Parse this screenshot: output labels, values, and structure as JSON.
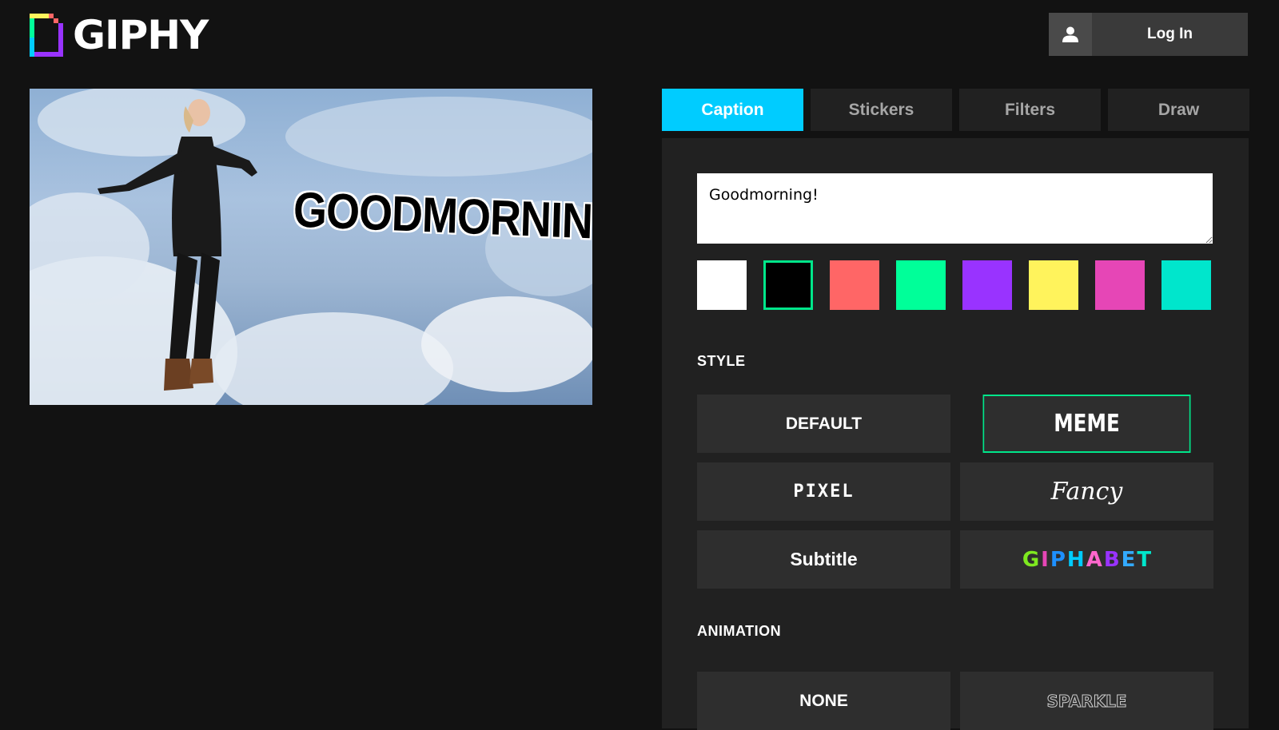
{
  "header": {
    "logo_text": "GIPHY",
    "login_label": "Log In",
    "login_icon": "user-icon"
  },
  "preview": {
    "caption": "GOODMORNING!"
  },
  "tabs": [
    {
      "label": "Caption",
      "active": true
    },
    {
      "label": "Stickers",
      "active": false
    },
    {
      "label": "Filters",
      "active": false
    },
    {
      "label": "Draw",
      "active": false
    }
  ],
  "caption_panel": {
    "input_value": "Goodmorning!",
    "colors": [
      "#ffffff",
      "#000000",
      "#ff6666",
      "#00ff99",
      "#9933ff",
      "#fff35c",
      "#e646b6",
      "#00e6cc"
    ],
    "selected_color": "#000000",
    "selected_color_border": "#00e68a",
    "style_label": "STYLE",
    "styles": [
      {
        "label": "DEFAULT",
        "selected": false
      },
      {
        "label": "MEME",
        "selected": true
      },
      {
        "label": "PIXEL",
        "selected": false
      },
      {
        "label": "Fancy",
        "selected": false
      },
      {
        "label": "Subtitle",
        "selected": false
      },
      {
        "label": "GIPHABET",
        "selected": false
      }
    ],
    "animation_label": "ANIMATION",
    "animations": [
      {
        "label": "NONE"
      },
      {
        "label": "SPARKLE"
      }
    ]
  },
  "colors": {
    "background": "#121212",
    "panel": "#212121",
    "tab_active": "#00ccff",
    "button": "#2e2e2e",
    "accent": "#00e68a"
  }
}
